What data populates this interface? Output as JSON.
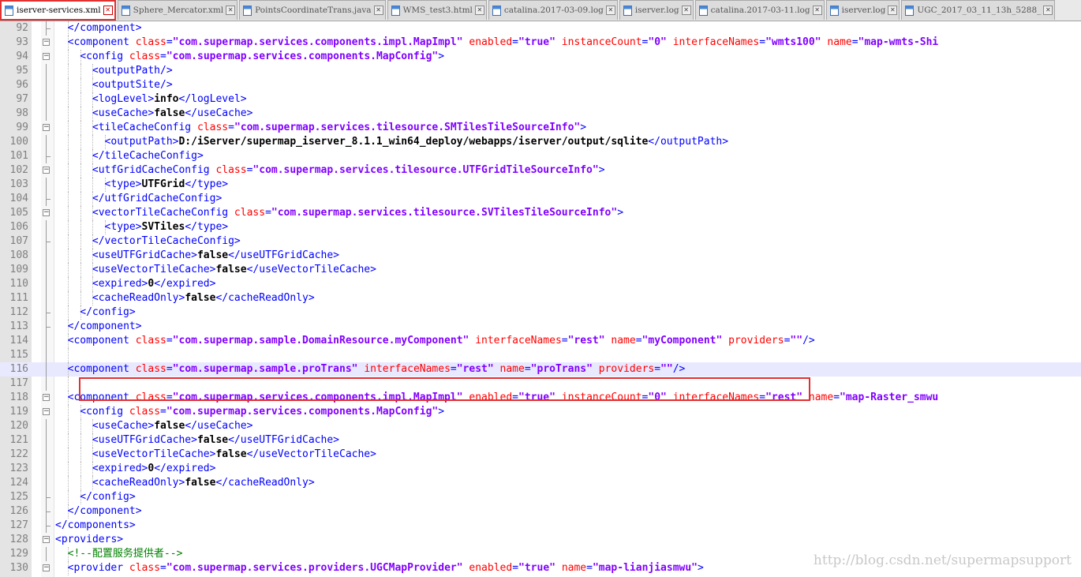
{
  "tabs": [
    {
      "label": "iserver-services.xml",
      "active": true
    },
    {
      "label": "Sphere_Mercator.xml"
    },
    {
      "label": "PointsCoordinateTrans.java"
    },
    {
      "label": "WMS_test3.html"
    },
    {
      "label": "catalina.2017-03-09.log"
    },
    {
      "label": "iserver.log"
    },
    {
      "label": "catalina.2017-03-11.log"
    },
    {
      "label": "iserver.log"
    },
    {
      "label": "UGC_2017_03_11_13h_5288_"
    }
  ],
  "lines": [
    {
      "n": "92",
      "d": 2,
      "f": "e",
      "s": [
        [
          "t",
          "</component>"
        ]
      ]
    },
    {
      "n": "93",
      "d": 2,
      "f": "-",
      "s": [
        [
          "t",
          "<component "
        ],
        [
          "a",
          "class"
        ],
        [
          "t",
          "="
        ],
        [
          "v",
          "\"com.supermap.services.components.impl.MapImpl\""
        ],
        [
          "t",
          " "
        ],
        [
          "a",
          "enabled"
        ],
        [
          "t",
          "="
        ],
        [
          "v",
          "\"true\""
        ],
        [
          "t",
          " "
        ],
        [
          "a",
          "instanceCount"
        ],
        [
          "t",
          "="
        ],
        [
          "v",
          "\"0\""
        ],
        [
          "t",
          " "
        ],
        [
          "a",
          "interfaceNames"
        ],
        [
          "t",
          "="
        ],
        [
          "v",
          "\"wmts100\""
        ],
        [
          "t",
          " "
        ],
        [
          "a",
          "name"
        ],
        [
          "t",
          "="
        ],
        [
          "v",
          "\"map-wmts-Shi"
        ]
      ]
    },
    {
      "n": "94",
      "d": 3,
      "f": "-",
      "s": [
        [
          "t",
          "<config "
        ],
        [
          "a",
          "class"
        ],
        [
          "t",
          "="
        ],
        [
          "v",
          "\"com.supermap.services.components.MapConfig\""
        ],
        [
          "t",
          ">"
        ]
      ]
    },
    {
      "n": "95",
      "d": 4,
      "f": "|",
      "s": [
        [
          "t",
          "<outputPath/>"
        ]
      ]
    },
    {
      "n": "96",
      "d": 4,
      "f": "|",
      "s": [
        [
          "t",
          "<outputSite/>"
        ]
      ]
    },
    {
      "n": "97",
      "d": 4,
      "f": "|",
      "s": [
        [
          "t",
          "<logLevel>"
        ],
        [
          "x",
          "info"
        ],
        [
          "t",
          "</logLevel>"
        ]
      ]
    },
    {
      "n": "98",
      "d": 4,
      "f": "|",
      "s": [
        [
          "t",
          "<useCache>"
        ],
        [
          "x",
          "false"
        ],
        [
          "t",
          "</useCache>"
        ]
      ]
    },
    {
      "n": "99",
      "d": 4,
      "f": "-",
      "s": [
        [
          "t",
          "<tileCacheConfig "
        ],
        [
          "a",
          "class"
        ],
        [
          "t",
          "="
        ],
        [
          "v",
          "\"com.supermap.services.tilesource.SMTilesTileSourceInfo\""
        ],
        [
          "t",
          ">"
        ]
      ]
    },
    {
      "n": "100",
      "d": 5,
      "f": "|",
      "s": [
        [
          "t",
          "<outputPath>"
        ],
        [
          "x",
          "D:/iServer/supermap_iserver_8.1.1_win64_deploy/webapps/iserver/output/sqlite"
        ],
        [
          "t",
          "</outputPath>"
        ]
      ]
    },
    {
      "n": "101",
      "d": 4,
      "f": "e",
      "s": [
        [
          "t",
          "</tileCacheConfig>"
        ]
      ]
    },
    {
      "n": "102",
      "d": 4,
      "f": "-",
      "s": [
        [
          "t",
          "<utfGridCacheConfig "
        ],
        [
          "a",
          "class"
        ],
        [
          "t",
          "="
        ],
        [
          "v",
          "\"com.supermap.services.tilesource.UTFGridTileSourceInfo\""
        ],
        [
          "t",
          ">"
        ]
      ]
    },
    {
      "n": "103",
      "d": 5,
      "f": "|",
      "s": [
        [
          "t",
          "<type>"
        ],
        [
          "x",
          "UTFGrid"
        ],
        [
          "t",
          "</type>"
        ]
      ]
    },
    {
      "n": "104",
      "d": 4,
      "f": "e",
      "s": [
        [
          "t",
          "</utfGridCacheConfig>"
        ]
      ]
    },
    {
      "n": "105",
      "d": 4,
      "f": "-",
      "s": [
        [
          "t",
          "<vectorTileCacheConfig "
        ],
        [
          "a",
          "class"
        ],
        [
          "t",
          "="
        ],
        [
          "v",
          "\"com.supermap.services.tilesource.SVTilesTileSourceInfo\""
        ],
        [
          "t",
          ">"
        ]
      ]
    },
    {
      "n": "106",
      "d": 5,
      "f": "|",
      "s": [
        [
          "t",
          "<type>"
        ],
        [
          "x",
          "SVTiles"
        ],
        [
          "t",
          "</type>"
        ]
      ]
    },
    {
      "n": "107",
      "d": 4,
      "f": "e",
      "s": [
        [
          "t",
          "</vectorTileCacheConfig>"
        ]
      ]
    },
    {
      "n": "108",
      "d": 4,
      "f": "|",
      "s": [
        [
          "t",
          "<useUTFGridCache>"
        ],
        [
          "x",
          "false"
        ],
        [
          "t",
          "</useUTFGridCache>"
        ]
      ]
    },
    {
      "n": "109",
      "d": 4,
      "f": "|",
      "s": [
        [
          "t",
          "<useVectorTileCache>"
        ],
        [
          "x",
          "false"
        ],
        [
          "t",
          "</useVectorTileCache>"
        ]
      ]
    },
    {
      "n": "110",
      "d": 4,
      "f": "|",
      "s": [
        [
          "t",
          "<expired>"
        ],
        [
          "x",
          "0"
        ],
        [
          "t",
          "</expired>"
        ]
      ]
    },
    {
      "n": "111",
      "d": 4,
      "f": "|",
      "s": [
        [
          "t",
          "<cacheReadOnly>"
        ],
        [
          "x",
          "false"
        ],
        [
          "t",
          "</cacheReadOnly>"
        ]
      ]
    },
    {
      "n": "112",
      "d": 3,
      "f": "e",
      "s": [
        [
          "t",
          "</config>"
        ]
      ]
    },
    {
      "n": "113",
      "d": 2,
      "f": "e",
      "s": [
        [
          "t",
          "</component>"
        ]
      ]
    },
    {
      "n": "114",
      "d": 2,
      "f": "|",
      "s": [
        [
          "t",
          "<component "
        ],
        [
          "a",
          "class"
        ],
        [
          "t",
          "="
        ],
        [
          "v",
          "\"com.supermap.sample.DomainResource.myComponent\""
        ],
        [
          "t",
          " "
        ],
        [
          "a",
          "interfaceNames"
        ],
        [
          "t",
          "="
        ],
        [
          "v",
          "\"rest\""
        ],
        [
          "t",
          " "
        ],
        [
          "a",
          "name"
        ],
        [
          "t",
          "="
        ],
        [
          "v",
          "\"myComponent\""
        ],
        [
          "t",
          " "
        ],
        [
          "a",
          "providers"
        ],
        [
          "t",
          "="
        ],
        [
          "v",
          "\"\""
        ],
        [
          "t",
          "/>"
        ]
      ]
    },
    {
      "n": "115",
      "d": 2,
      "f": "|",
      "s": []
    },
    {
      "n": "116",
      "d": 2,
      "f": "|",
      "cur": true,
      "s": [
        [
          "t",
          "<component "
        ],
        [
          "a",
          "class"
        ],
        [
          "t",
          "="
        ],
        [
          "v",
          "\"com.supermap.sample.proTrans\""
        ],
        [
          "t",
          " "
        ],
        [
          "a",
          "interfaceNames"
        ],
        [
          "t",
          "="
        ],
        [
          "v",
          "\"rest\""
        ],
        [
          "t",
          " "
        ],
        [
          "a",
          "name"
        ],
        [
          "t",
          "="
        ],
        [
          "v",
          "\"proTrans\""
        ],
        [
          "t",
          " "
        ],
        [
          "a",
          "providers"
        ],
        [
          "t",
          "="
        ],
        [
          "v",
          "\"\""
        ],
        [
          "t",
          "/>"
        ]
      ]
    },
    {
      "n": "117",
      "d": 2,
      "f": "|",
      "s": []
    },
    {
      "n": "118",
      "d": 2,
      "f": "-",
      "s": [
        [
          "t",
          "<component "
        ],
        [
          "a",
          "class"
        ],
        [
          "t",
          "="
        ],
        [
          "v",
          "\"com.supermap.services.components.impl.MapImpl\""
        ],
        [
          "t",
          " "
        ],
        [
          "a",
          "enabled"
        ],
        [
          "t",
          "="
        ],
        [
          "v",
          "\"true\""
        ],
        [
          "t",
          " "
        ],
        [
          "a",
          "instanceCount"
        ],
        [
          "t",
          "="
        ],
        [
          "v",
          "\"0\""
        ],
        [
          "t",
          " "
        ],
        [
          "a",
          "interfaceNames"
        ],
        [
          "t",
          "="
        ],
        [
          "v",
          "\"rest\""
        ],
        [
          "t",
          " "
        ],
        [
          "a",
          "name"
        ],
        [
          "t",
          "="
        ],
        [
          "v",
          "\"map-Raster_smwu"
        ]
      ]
    },
    {
      "n": "119",
      "d": 3,
      "f": "-",
      "s": [
        [
          "t",
          "<config "
        ],
        [
          "a",
          "class"
        ],
        [
          "t",
          "="
        ],
        [
          "v",
          "\"com.supermap.services.components.MapConfig\""
        ],
        [
          "t",
          ">"
        ]
      ]
    },
    {
      "n": "120",
      "d": 4,
      "f": "|",
      "s": [
        [
          "t",
          "<useCache>"
        ],
        [
          "x",
          "false"
        ],
        [
          "t",
          "</useCache>"
        ]
      ]
    },
    {
      "n": "121",
      "d": 4,
      "f": "|",
      "s": [
        [
          "t",
          "<useUTFGridCache>"
        ],
        [
          "x",
          "false"
        ],
        [
          "t",
          "</useUTFGridCache>"
        ]
      ]
    },
    {
      "n": "122",
      "d": 4,
      "f": "|",
      "s": [
        [
          "t",
          "<useVectorTileCache>"
        ],
        [
          "x",
          "false"
        ],
        [
          "t",
          "</useVectorTileCache>"
        ]
      ]
    },
    {
      "n": "123",
      "d": 4,
      "f": "|",
      "s": [
        [
          "t",
          "<expired>"
        ],
        [
          "x",
          "0"
        ],
        [
          "t",
          "</expired>"
        ]
      ]
    },
    {
      "n": "124",
      "d": 4,
      "f": "|",
      "s": [
        [
          "t",
          "<cacheReadOnly>"
        ],
        [
          "x",
          "false"
        ],
        [
          "t",
          "</cacheReadOnly>"
        ]
      ]
    },
    {
      "n": "125",
      "d": 3,
      "f": "e",
      "s": [
        [
          "t",
          "</config>"
        ]
      ]
    },
    {
      "n": "126",
      "d": 2,
      "f": "e",
      "s": [
        [
          "t",
          "</component>"
        ]
      ]
    },
    {
      "n": "127",
      "d": 1,
      "f": "e",
      "s": [
        [
          "t",
          "</components>"
        ]
      ]
    },
    {
      "n": "128",
      "d": 1,
      "f": "-",
      "s": [
        [
          "t",
          "<providers>"
        ]
      ]
    },
    {
      "n": "129",
      "d": 2,
      "f": "|",
      "s": [
        [
          "c",
          "<!--配置服务提供者-->"
        ]
      ]
    },
    {
      "n": "130",
      "d": 2,
      "f": "-",
      "s": [
        [
          "t",
          "<provider "
        ],
        [
          "a",
          "class"
        ],
        [
          "t",
          "="
        ],
        [
          "v",
          "\"com.supermap.services.providers.UGCMapProvider\""
        ],
        [
          "t",
          " "
        ],
        [
          "a",
          "enabled"
        ],
        [
          "t",
          "="
        ],
        [
          "v",
          "\"true\""
        ],
        [
          "t",
          " "
        ],
        [
          "a",
          "name"
        ],
        [
          "t",
          "="
        ],
        [
          "v",
          "\"map-lianjiasmwu\""
        ],
        [
          "t",
          ">"
        ]
      ]
    }
  ],
  "watermark": "http://blog.csdn.net/supermapsupport"
}
